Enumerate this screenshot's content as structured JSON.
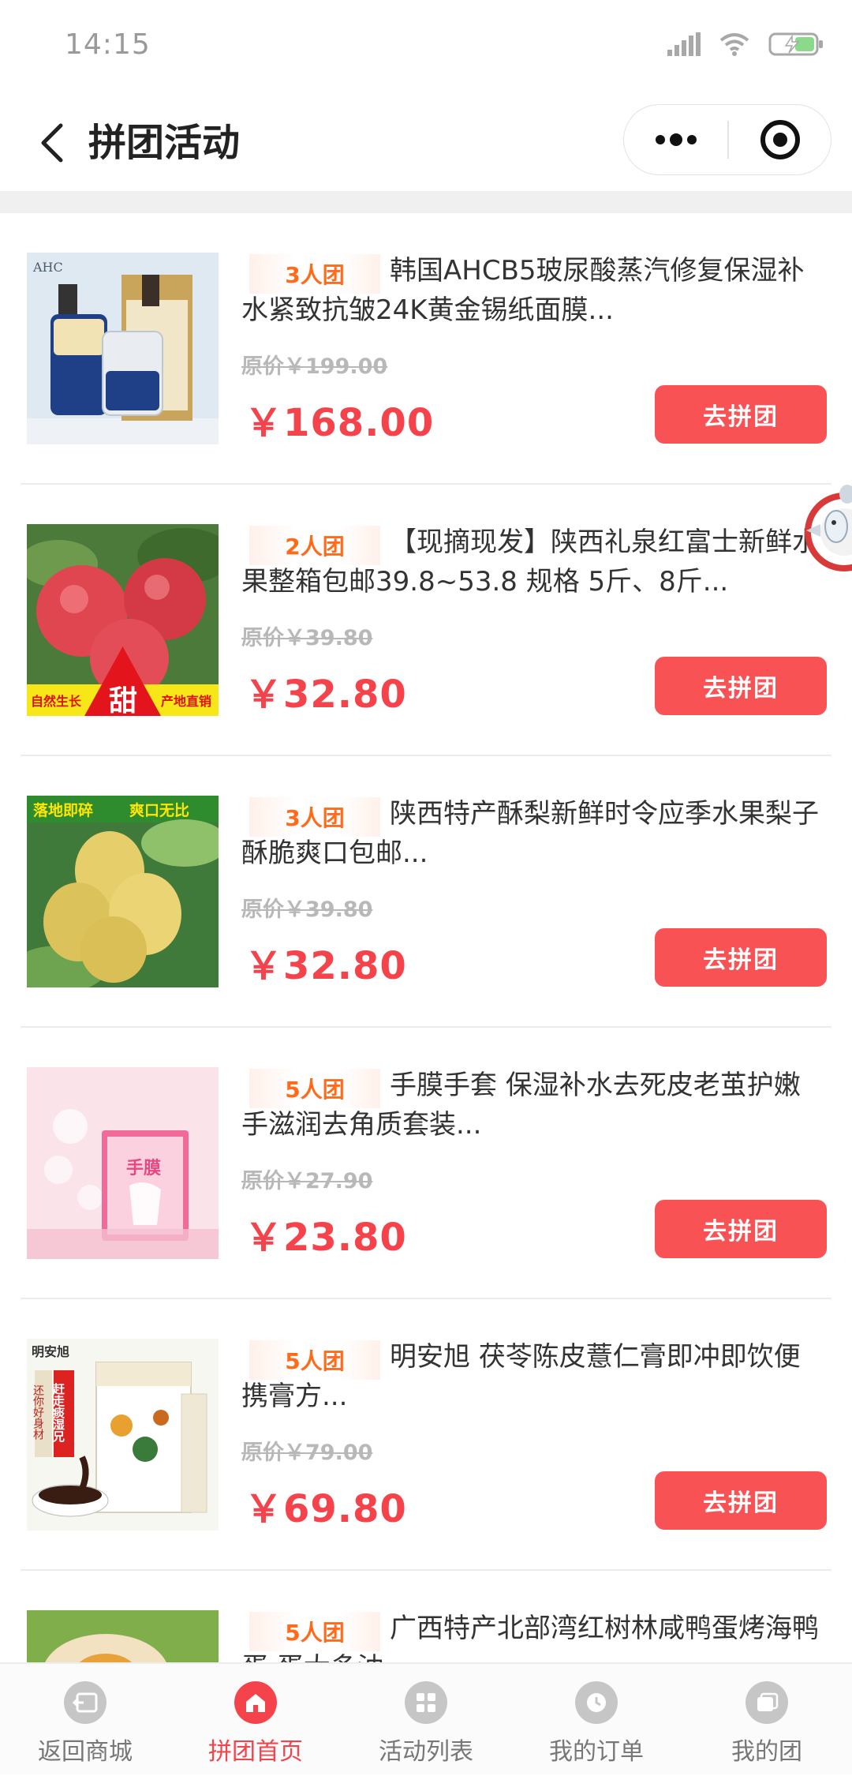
{
  "status": {
    "time": "14:15"
  },
  "nav": {
    "title": "拼团活动"
  },
  "items": [
    {
      "badge": "3人团",
      "title": "韩国AHCB5玻尿酸蒸汽修复保湿补水紧致抗皱24K黄金锡纸面膜...",
      "old_price": "原价￥199.00",
      "price": "￥168.00",
      "button": "去拼团",
      "image": "serum-bottles"
    },
    {
      "badge": "2人团",
      "title": "【现摘现发】陕西礼泉红富士新鲜水果整箱包邮39.8~53.8 规格 5斤、8斤...",
      "old_price": "原价￥39.80",
      "price": "￥32.80",
      "button": "去拼团",
      "image": "red-apples",
      "image_text": {
        "left": "自然生长",
        "center": "甜",
        "right": "产地直销"
      }
    },
    {
      "badge": "3人团",
      "title": "陕西特产酥梨新鲜时令应季水果梨子酥脆爽口包邮...",
      "old_price": "原价￥39.80",
      "price": "￥32.80",
      "button": "去拼团",
      "image": "pears",
      "image_text": {
        "left": "落地即碎",
        "right": "爽口无比"
      }
    },
    {
      "badge": "5人团",
      "title": "手膜手套 保湿补水去死皮老茧护嫩手滋润去角质套装...",
      "old_price": "原价￥27.90",
      "price": "￥23.80",
      "button": "去拼团",
      "image": "hand-mask",
      "image_text": {
        "center": "手膜"
      }
    },
    {
      "badge": "5人团",
      "title": "明安旭 茯苓陈皮薏仁膏即冲即饮便携膏方...",
      "old_price": "原价￥79.00",
      "price": "￥69.80",
      "button": "去拼团",
      "image": "herbal-paste",
      "image_text": {
        "brand": "明安旭",
        "side": "还你好身材",
        "tag": "赶走痰湿兄"
      }
    },
    {
      "badge": "5人团",
      "title": "广西特产北部湾红树林咸鸭蛋烤海鸭蛋 蛋大多油",
      "old_price": "",
      "price": "",
      "button": "",
      "image": "duck-eggs"
    }
  ],
  "tabbar": [
    {
      "label": "返回商城",
      "icon": "back-store-icon",
      "active": false
    },
    {
      "label": "拼团首页",
      "icon": "home-icon",
      "active": true
    },
    {
      "label": "活动列表",
      "icon": "grid-icon",
      "active": false
    },
    {
      "label": "我的订单",
      "icon": "clock-icon",
      "active": false
    },
    {
      "label": "我的团",
      "icon": "group-icon",
      "active": false
    }
  ],
  "colors": {
    "accent": "#f4434b",
    "badge": "#ff6b1a",
    "button": "#f85255"
  }
}
